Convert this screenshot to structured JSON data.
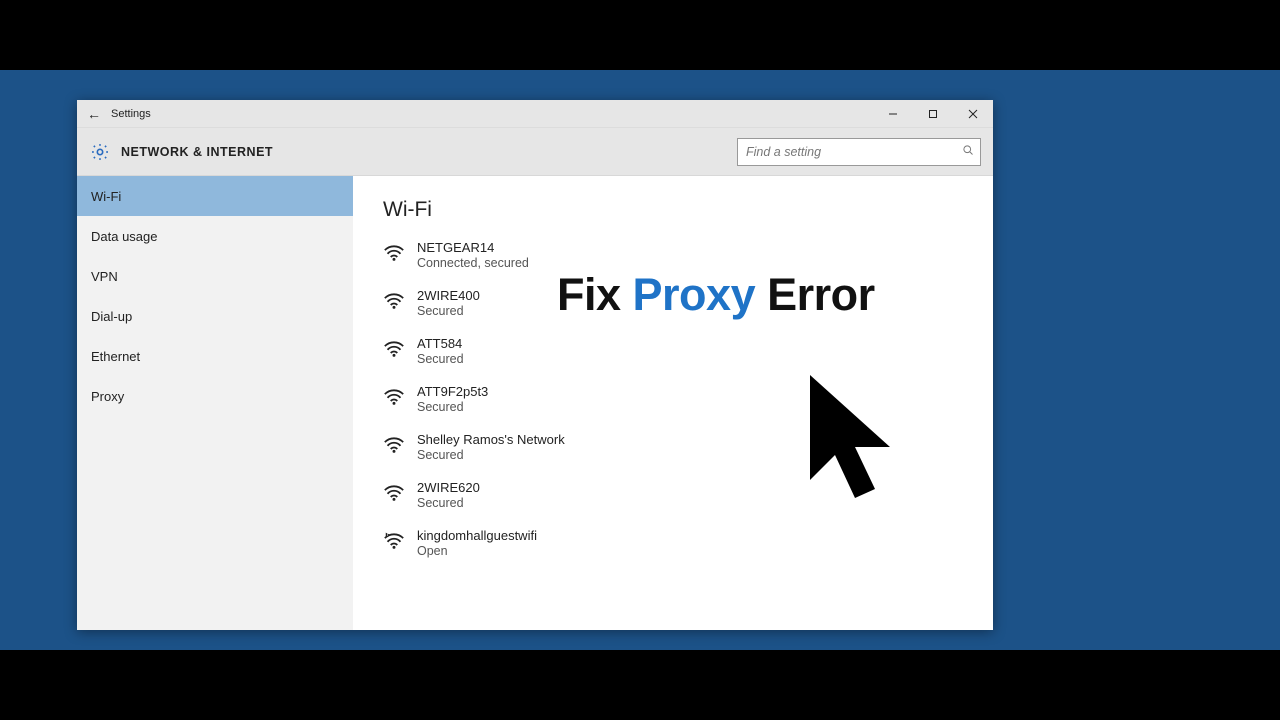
{
  "titlebar": {
    "back_glyph": "←",
    "title": "Settings"
  },
  "header": {
    "section_title": "NETWORK & INTERNET",
    "search_placeholder": "Find a setting"
  },
  "sidebar": {
    "items": [
      {
        "label": "Wi-Fi",
        "selected": true
      },
      {
        "label": "Data usage",
        "selected": false
      },
      {
        "label": "VPN",
        "selected": false
      },
      {
        "label": "Dial-up",
        "selected": false
      },
      {
        "label": "Ethernet",
        "selected": false
      },
      {
        "label": "Proxy",
        "selected": false
      }
    ]
  },
  "content": {
    "title": "Wi-Fi",
    "networks": [
      {
        "name": "NETGEAR14",
        "status": "Connected, secured",
        "open": false
      },
      {
        "name": "2WIRE400",
        "status": "Secured",
        "open": false
      },
      {
        "name": "ATT584",
        "status": "Secured",
        "open": false
      },
      {
        "name": "ATT9F2p5t3",
        "status": "Secured",
        "open": false
      },
      {
        "name": "Shelley Ramos's Network",
        "status": "Secured",
        "open": false
      },
      {
        "name": "2WIRE620",
        "status": "Secured",
        "open": false
      },
      {
        "name": "kingdomhallguestwifi",
        "status": "Open",
        "open": true
      }
    ]
  },
  "overlay": {
    "part1": "Fix ",
    "accent": "Proxy",
    "part2": " Error"
  }
}
